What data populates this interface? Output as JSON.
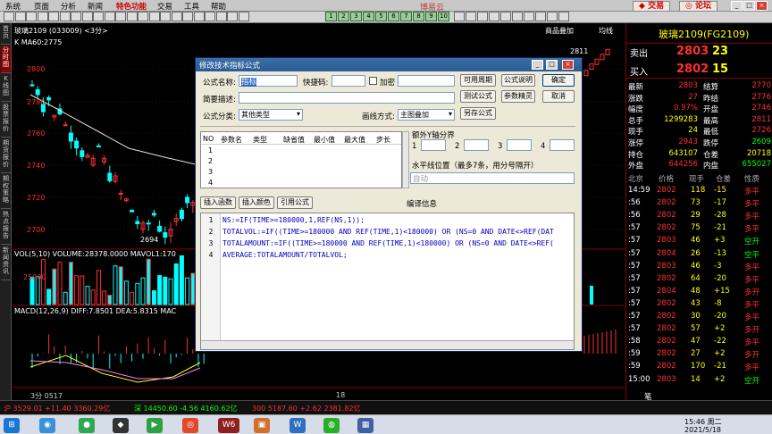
{
  "menu": {
    "items": [
      "系统",
      "页面",
      "分析",
      "新闻",
      "特色功能",
      "交易",
      "工具",
      "帮助"
    ],
    "special_index": 4,
    "app_title": "博易云"
  },
  "toolbar": {
    "trade_label": "交易",
    "forum_label": "论坛",
    "buttons": [
      "1",
      "2",
      "3",
      "4",
      "5",
      "6",
      "7",
      "8",
      "9",
      "10"
    ]
  },
  "left_tabs": [
    "首页",
    "分时图",
    "K线图",
    "股票报价",
    "期货报价",
    "期权策略",
    "热点报告",
    "新闻资讯"
  ],
  "chart": {
    "header": "玻璃2109 (033009) <3分>",
    "ma_label": "K MA60:2775",
    "top_right_label": "商品叠加",
    "top_right_label2": "均线",
    "price_labels": [
      "2800",
      "2780",
      "2760",
      "2740",
      "2720",
      "2700"
    ],
    "high_label": "2811",
    "low_label": "2694",
    "vol_label": "VOL(5,10) VOLUME:28378.0000 MAVOL1:170",
    "vol_axis": "25000",
    "macd_label": "MACD(12,26,9) DIFF:7.8501 DEA:5.8315 MAC",
    "bottom_time_left": "3分 0517",
    "bottom_time_mid": "18"
  },
  "right_panel": {
    "title": "玻璃2109(FG2109)",
    "sell": {
      "label": "卖出",
      "price": "2803",
      "qty": "23"
    },
    "buy": {
      "label": "买入",
      "price": "2802",
      "qty": "15"
    },
    "stats": [
      [
        "最新",
        "2803",
        "结算",
        "2770"
      ],
      [
        "涨跌",
        "27",
        "昨结",
        "2776"
      ],
      [
        "幅度",
        "0.97%",
        "开盘",
        "2746"
      ],
      [
        "总手",
        "1299283",
        "最高",
        "2811"
      ],
      [
        "现手",
        "24",
        "最低",
        "2726"
      ],
      [
        "涨停",
        "2943",
        "跌停",
        "2609"
      ],
      [
        "持仓",
        "643107",
        "仓差",
        "20718"
      ],
      [
        "外盘",
        "644256",
        "内盘",
        "655027"
      ]
    ],
    "tick_header": [
      "北京",
      "价格",
      "现手",
      "仓差",
      "性质"
    ],
    "ticks": [
      [
        "14:59",
        "2802",
        "118",
        "-15",
        "多平"
      ],
      [
        ":56",
        "2802",
        "73",
        "-17",
        "多平"
      ],
      [
        ":56",
        "2802",
        "29",
        "-28",
        "多平"
      ],
      [
        ":57",
        "2802",
        "75",
        "-21",
        "多平"
      ],
      [
        ":57",
        "2803",
        "46",
        "+3",
        "空开"
      ],
      [
        ":57",
        "2804",
        "26",
        "-13",
        "空平"
      ],
      [
        ":57",
        "2803",
        "46",
        "-3",
        "多平"
      ],
      [
        ":57",
        "2802",
        "64",
        "-20",
        "多平"
      ],
      [
        ":57",
        "2804",
        "48",
        "+15",
        "多开"
      ],
      [
        ":57",
        "2802",
        "43",
        "-8",
        "多平"
      ],
      [
        ":57",
        "2802",
        "30",
        "-20",
        "多平"
      ],
      [
        ":57",
        "2802",
        "57",
        "+2",
        "多开"
      ],
      [
        ":58",
        "2802",
        "47",
        "-22",
        "多平"
      ],
      [
        ":59",
        "2802",
        "27",
        "+2",
        "多开"
      ],
      [
        ":59",
        "2802",
        "170",
        "-21",
        "多平"
      ],
      [
        "15:00",
        "2803",
        "14",
        "+2",
        "空开"
      ]
    ],
    "footer": "笔"
  },
  "dialog": {
    "title": "修改技术指标公式",
    "name_label": "公式名称:",
    "name_value": "指标",
    "pwd_label": "快捷码:",
    "encrypt_label": "加密",
    "desc_label": "简要描述:",
    "category_label": "公式分类:",
    "category_value": "其他类型",
    "drawmode_label": "画线方式:",
    "drawmode_value": "主图叠加",
    "btn_period": "可用周期",
    "btn_explain": "公式说明",
    "btn_ok": "确定",
    "btn_test": "测试公式",
    "btn_param": "参数精灵",
    "btn_cancel": "取消",
    "btn_saveas": "另存公式",
    "param_headers": [
      "NO",
      "参数名",
      "类型",
      "缺省值",
      "最小值",
      "最大值",
      "步长"
    ],
    "param_rows": [
      "1",
      "2",
      "3",
      "4"
    ],
    "extra_axis_label": "额外Y轴分界",
    "axis_nums": [
      "1",
      "2",
      "3",
      "4"
    ],
    "hline_label": "水平线位置（最多7条，用分号隔开）",
    "hline_placeholder": "自动",
    "btn_insert_func": "插入函数",
    "btn_insert_color": "插入颜色",
    "btn_ref": "引用公式",
    "compile_label": "编译信息",
    "code_lines": [
      "NS:=IF(TIME>=180000,1,REF(NS,1));",
      "TOTALVOL:=IF((TIME>=180000 AND REF(TIME,1)<180000) OR (NS=0 AND DATE<>REF(DAT",
      "TOTALAMOUNT:=IF((TIME>=180000 AND REF(TIME,1)<180000) OR (NS=0 AND DATE<>REF(",
      "AVERAGE:TOTALAMOUNT/TOTALVOL;"
    ]
  },
  "statusbar": {
    "left": "沪 3529.01 +11.40 3360.29亿",
    "mid1": "深 14450.60 -4.56 4160.62亿",
    "mid2": "300 5187.60 +2.62 2381.82亿"
  },
  "taskbar": {
    "time": "15:46 周二",
    "date": "2021/5/18"
  },
  "colors": {
    "up": "#ff3030",
    "down": "#00ffff",
    "yellow": "#ffff00",
    "accent": "#0a246a"
  }
}
